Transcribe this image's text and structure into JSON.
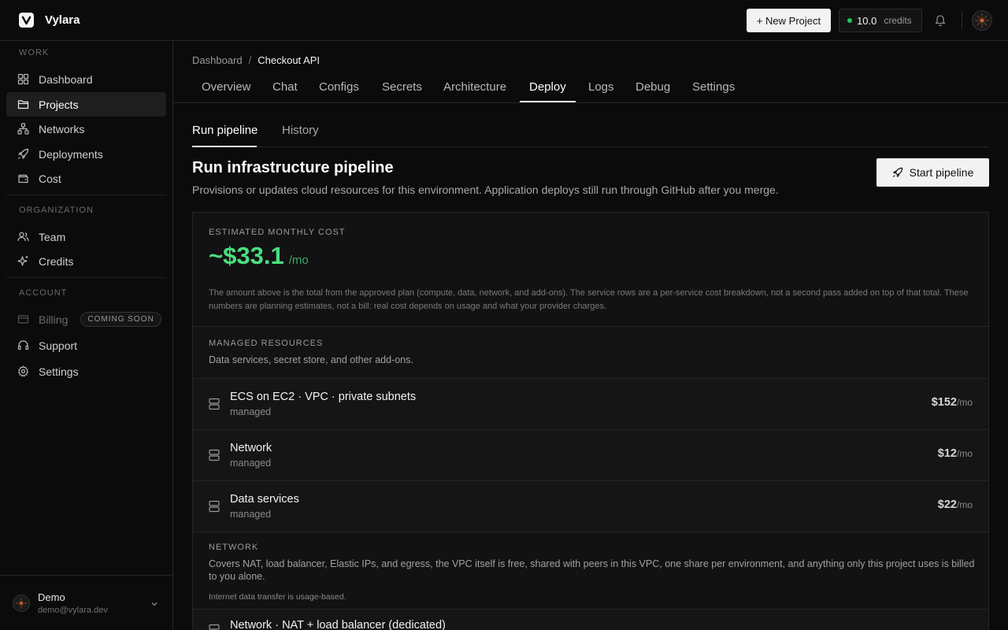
{
  "app": {
    "name": "Vylara"
  },
  "topbar": {
    "new_project_label": "+ New Project",
    "credits_value": "10.0",
    "credits_label": "credits",
    "status_color": "#22c55e"
  },
  "sidebar": {
    "sections": {
      "work": "WORK",
      "organization": "ORGANIZATION",
      "account": "ACCOUNT"
    },
    "items": {
      "dashboard": "Dashboard",
      "projects": "Projects",
      "networks": "Networks",
      "deployments": "Deployments",
      "cost": "Cost",
      "team": "Team",
      "credits": "Credits",
      "billing": "Billing",
      "billing_badge": "COMING SOON",
      "support": "Support",
      "settings": "Settings"
    },
    "active_item": "Projects",
    "user": {
      "name": "Demo",
      "email": "demo@vylara.dev"
    }
  },
  "breadcrumb": {
    "parent": "Dashboard",
    "separator": "/",
    "current": "Checkout API"
  },
  "tabs": [
    "Overview",
    "Chat",
    "Configs",
    "Secrets",
    "Architecture",
    "Deploy",
    "Logs",
    "Debug",
    "Settings"
  ],
  "active_tab": "Deploy",
  "subtabs": [
    "Run pipeline",
    "History"
  ],
  "active_subtab": "Run pipeline",
  "page": {
    "title": "Run infrastructure pipeline",
    "description": "Provisions or updates cloud resources for this environment. Application deploys still run through GitHub after you merge.",
    "start_button": "Start pipeline"
  },
  "cost": {
    "label": "ESTIMATED MONTHLY COST",
    "value": "~$33.1",
    "unit": "/mo",
    "accent": "#4ade80",
    "note": "The amount above is the total from the approved plan (compute, data, network, and add-ons). The service rows are a per-service cost breakdown, not a second pass added on top of that total. These numbers are planning estimates, not a bill: real cost depends on usage and what your provider charges."
  },
  "managed": {
    "label": "MANAGED RESOURCES",
    "description": "Data services, secret store, and other add-ons.",
    "rows": [
      {
        "name": "ECS on EC2 · VPC · private subnets",
        "sub": "managed",
        "price": "$152",
        "unit": "/mo"
      },
      {
        "name": "Network",
        "sub": "managed",
        "price": "$12",
        "unit": "/mo"
      },
      {
        "name": "Data services",
        "sub": "managed",
        "price": "$22",
        "unit": "/mo"
      }
    ]
  },
  "network": {
    "label": "NETWORK",
    "description": "Covers NAT, load balancer, Elastic IPs, and egress, the VPC itself is free, shared with peers in this VPC, one share per environment, and anything only this project uses is billed to you alone.",
    "note": "Internet data transfer is usage-based.",
    "row_name": "Network · NAT + load balancer (dedicated)"
  }
}
